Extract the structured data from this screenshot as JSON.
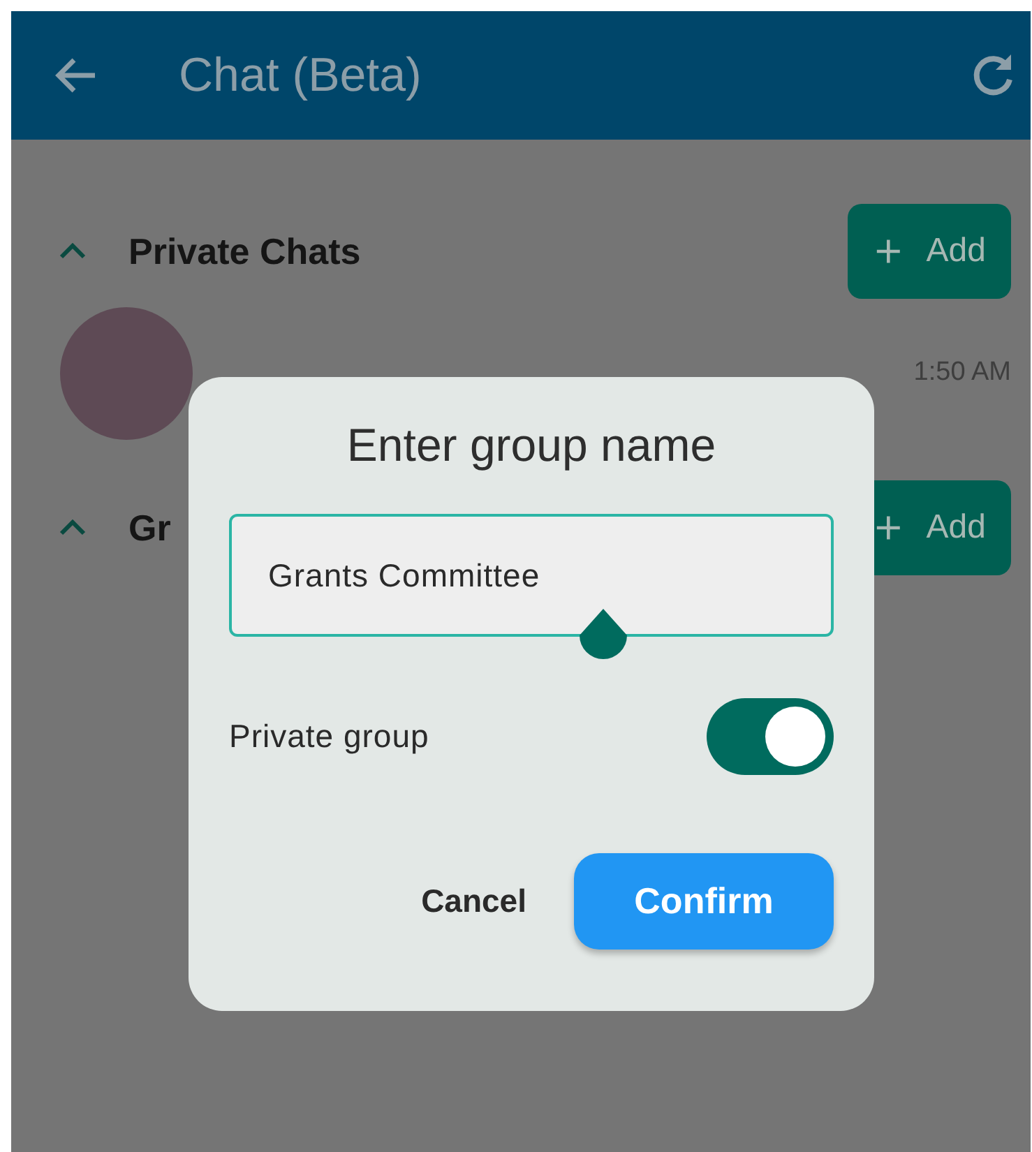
{
  "app_bar": {
    "title": "Chat (Beta)"
  },
  "sections": [
    {
      "title": "Private Chats",
      "expanded": true,
      "add_label": "Add",
      "items": [
        {
          "time": "1:50 AM"
        }
      ]
    },
    {
      "title": "Gr",
      "expanded": true,
      "add_label": "Add"
    }
  ],
  "dialog": {
    "title": "Enter group name",
    "field": {
      "value": "Grants Committee"
    },
    "toggle": {
      "label": "Private group",
      "on": true
    },
    "buttons": [
      {
        "label": "Cancel",
        "kind": "text"
      },
      {
        "label": "Confirm",
        "kind": "filled"
      }
    ]
  }
}
